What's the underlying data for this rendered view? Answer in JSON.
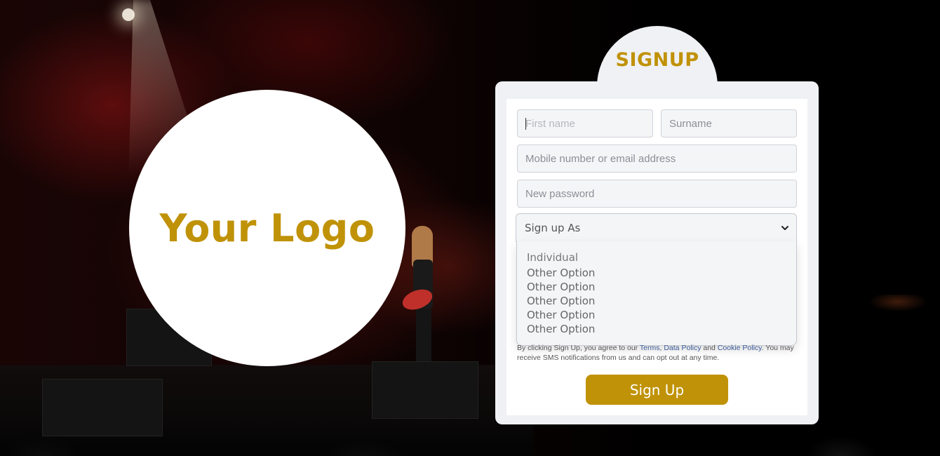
{
  "logo": {
    "text": "Your Logo"
  },
  "signup": {
    "title": "SIGNUP",
    "first_name_placeholder": "First name",
    "surname_placeholder": "Surname",
    "contact_placeholder": "Mobile number or email address",
    "password_placeholder": "New password",
    "signup_as": {
      "selected": "Sign up As",
      "options": [
        "Individual",
        "Other Option",
        "Other Option",
        "Other Option",
        "Other Option",
        "Other Option"
      ]
    },
    "terms": {
      "prefix": "By clicking Sign Up, you agree to our ",
      "terms_link": "Terms",
      "sep1": ", ",
      "data_policy_link": "Data Policy",
      "sep2": " and ",
      "cookie_policy_link": "Cookie Policy",
      "suffix": ". You may receive SMS notifications from us and can opt out at any time."
    },
    "button_label": "Sign Up"
  },
  "colors": {
    "accent": "#c09207",
    "card_bg": "#f0f1f4",
    "link": "#385898"
  }
}
